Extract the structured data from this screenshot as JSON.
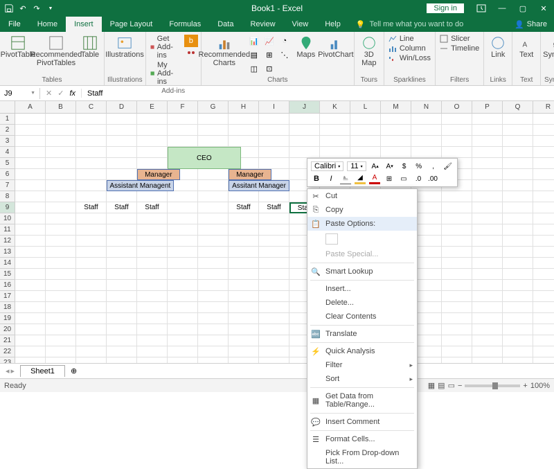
{
  "colors": {
    "accent": "#0f7040"
  },
  "titlebar": {
    "title": "Book1 - Excel",
    "signin": "Sign in"
  },
  "tabs": {
    "file": "File",
    "items": [
      "Home",
      "Insert",
      "Page Layout",
      "Formulas",
      "Data",
      "Review",
      "View",
      "Help"
    ],
    "active": "Insert",
    "tellme": "Tell me what you want to do",
    "share": "Share"
  },
  "ribbon": {
    "groups": {
      "tables": {
        "label": "Tables",
        "pivot": "PivotTable",
        "rec": "Recommended PivotTables",
        "table": "Table"
      },
      "illus": {
        "label": "Illustrations",
        "btn": "Illustrations"
      },
      "addins": {
        "label": "Add-ins",
        "get": "Get Add-ins",
        "my": "My Add-ins"
      },
      "charts": {
        "label": "Charts",
        "rec": "Recommended Charts",
        "maps": "Maps",
        "pivot": "PivotChart"
      },
      "tours": {
        "label": "Tours",
        "btn": "3D Map"
      },
      "sparklines": {
        "label": "Sparklines",
        "line": "Line",
        "column": "Column",
        "winloss": "Win/Loss"
      },
      "filters": {
        "label": "Filters",
        "slicer": "Slicer",
        "timeline": "Timeline"
      },
      "links": {
        "label": "Links",
        "link": "Link"
      },
      "text": {
        "label": "Text",
        "btn": "Text"
      },
      "symbols": {
        "label": "Symbols",
        "btn": "Symbols"
      }
    }
  },
  "formula_bar": {
    "namebox": "J9",
    "value": "Staff"
  },
  "columns": [
    "A",
    "B",
    "C",
    "D",
    "E",
    "F",
    "G",
    "H",
    "I",
    "J",
    "K",
    "L",
    "M",
    "N",
    "O",
    "P",
    "Q",
    "R"
  ],
  "rows_visible": 24,
  "selected": {
    "col": "J",
    "row": 9
  },
  "cells": {
    "ceo": "CEO",
    "mgr1": "Manager",
    "mgr2": "Manager",
    "asst1": "Assistant Managent",
    "asst2": "Assitant Manager",
    "staff": "Staff"
  },
  "sheets": {
    "active": "Sheet1"
  },
  "statusbar": {
    "ready": "Ready",
    "zoom": "100%"
  },
  "mini_toolbar": {
    "font": "Calibri",
    "size": "11"
  },
  "context_menu": {
    "cut": "Cut",
    "copy": "Copy",
    "paste_options": "Paste Options:",
    "paste_special": "Paste Special...",
    "smart_lookup": "Smart Lookup",
    "insert": "Insert...",
    "delete": "Delete...",
    "clear": "Clear Contents",
    "translate": "Translate",
    "quick": "Quick Analysis",
    "filter": "Filter",
    "sort": "Sort",
    "get_data": "Get Data from Table/Range...",
    "comment": "Insert Comment",
    "format": "Format Cells...",
    "dropdown": "Pick From Drop-down List..."
  }
}
